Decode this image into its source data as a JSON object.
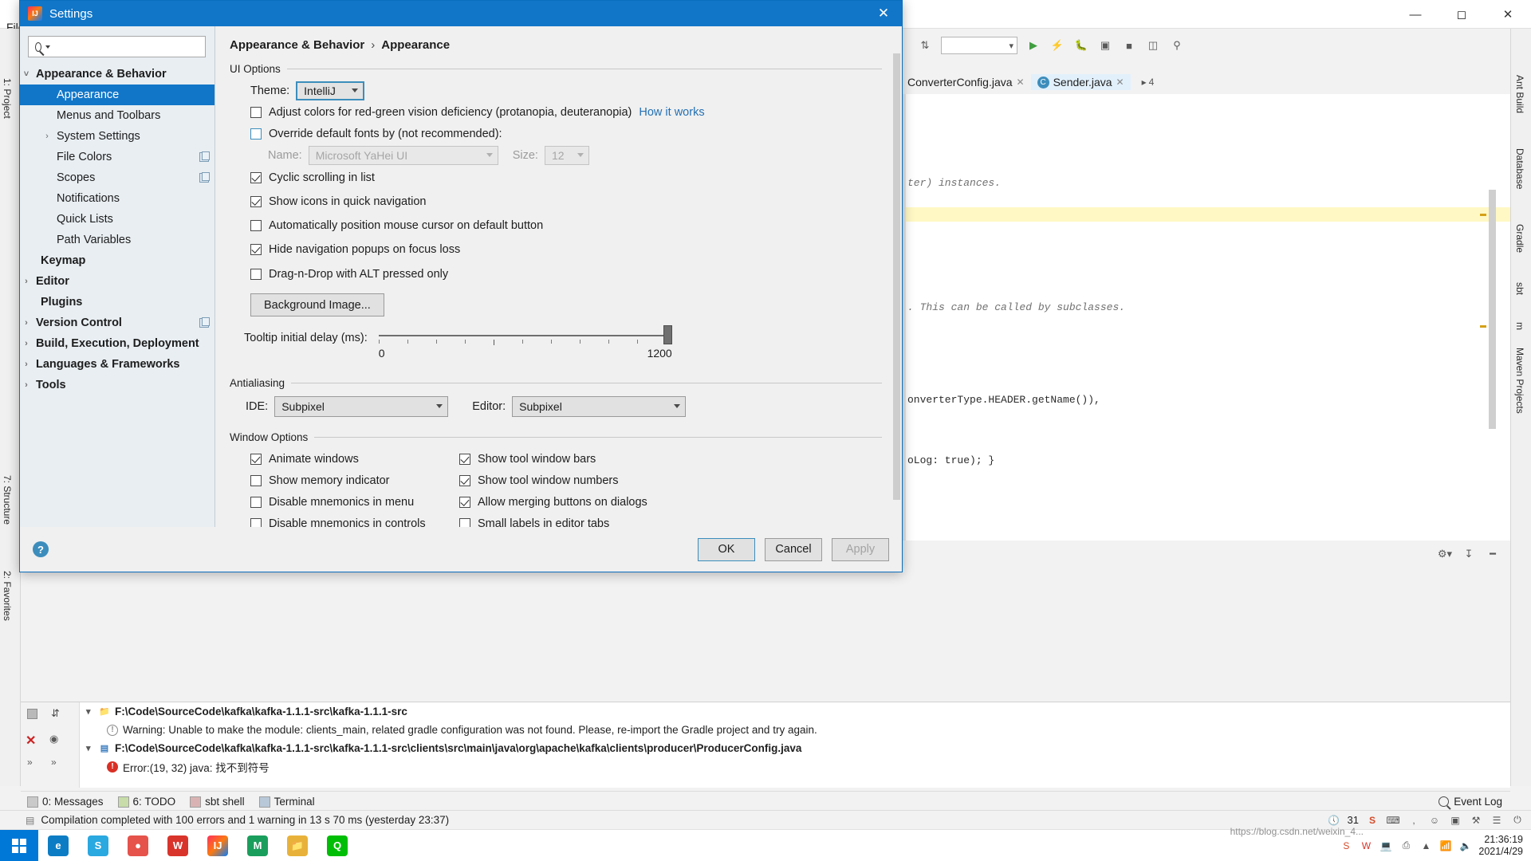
{
  "ide": {
    "menu_label": "File",
    "left_strip": [
      "1: Project",
      "7: Structure",
      "2: Favorites"
    ],
    "right_strip": [
      "Ant Build",
      "Database",
      "Gradle",
      "sbt",
      "m",
      "Maven Projects"
    ],
    "tabs": [
      {
        "label": "ConverterConfig.java",
        "badge": "",
        "active": false
      },
      {
        "label": "Sender.java",
        "badge": "C",
        "active": true
      }
    ],
    "tab_counter": "4",
    "code_lines": [
      "ter) instances.",
      ". This can be called by subclasses.",
      "onverterType.HEADER.getName()),",
      "oLog: true); }"
    ],
    "messages": [
      {
        "type": "folder",
        "bold": true,
        "text": "F:\\Code\\SourceCode\\kafka\\kafka-1.1.1-src\\kafka-1.1.1-src"
      },
      {
        "type": "warning",
        "bold": false,
        "text": "Warning: Unable to make the module: clients_main, related gradle configuration was not found. Please, re-import the Gradle project and try again."
      },
      {
        "type": "file",
        "bold": true,
        "text": "F:\\Code\\SourceCode\\kafka\\kafka-1.1.1-src\\kafka-1.1.1-src\\clients\\src\\main\\java\\org\\apache\\kafka\\clients\\producer\\ProducerConfig.java"
      },
      {
        "type": "error",
        "bold": false,
        "text": "Error:(19, 32)  java: 找不到符号"
      }
    ],
    "tool_tabs": [
      {
        "label": "0: Messages",
        "mnemonic": "0"
      },
      {
        "label": "6: TODO",
        "mnemonic": "6"
      },
      {
        "label": "sbt shell",
        "mnemonic": ""
      },
      {
        "label": "Terminal",
        "mnemonic": ""
      }
    ],
    "event_log": "Event Log",
    "status_text": "Compilation completed with 100 errors and 1 warning in 13 s 70 ms (yesterday 23:37)",
    "status_count": "31",
    "clock_time": "21:36:19",
    "clock_date": "2021/4/29",
    "watermark_url": "https://blog.csdn.net/weixin_4...",
    "watermark_2": "2021/4/29"
  },
  "dialog": {
    "title": "Settings",
    "logo_text": "IJ",
    "close_icon": "✕",
    "search": {
      "placeholder": "",
      "value": ""
    },
    "breadcrumb": {
      "parent": "Appearance & Behavior",
      "separator": "›",
      "current": "Appearance"
    },
    "sidebar": [
      {
        "label": "Appearance & Behavior",
        "level": 0,
        "arrow": "expanded",
        "bold": true,
        "selected": false,
        "badge": false
      },
      {
        "label": "Appearance",
        "level": 1,
        "arrow": "none",
        "bold": false,
        "selected": true,
        "badge": false
      },
      {
        "label": "Menus and Toolbars",
        "level": 1,
        "arrow": "none",
        "bold": false,
        "selected": false,
        "badge": false
      },
      {
        "label": "System Settings",
        "level": 1,
        "arrow": "collapsed",
        "bold": false,
        "selected": false,
        "badge": false
      },
      {
        "label": "File Colors",
        "level": 1,
        "arrow": "none",
        "bold": false,
        "selected": false,
        "badge": true
      },
      {
        "label": "Scopes",
        "level": 1,
        "arrow": "none",
        "bold": false,
        "selected": false,
        "badge": true
      },
      {
        "label": "Notifications",
        "level": 1,
        "arrow": "none",
        "bold": false,
        "selected": false,
        "badge": false
      },
      {
        "label": "Quick Lists",
        "level": 1,
        "arrow": "none",
        "bold": false,
        "selected": false,
        "badge": false
      },
      {
        "label": "Path Variables",
        "level": 1,
        "arrow": "none",
        "bold": false,
        "selected": false,
        "badge": false
      },
      {
        "label": "Keymap",
        "level": 0,
        "arrow": "none",
        "bold": true,
        "selected": false,
        "badge": false
      },
      {
        "label": "Editor",
        "level": 0,
        "arrow": "collapsed",
        "bold": true,
        "selected": false,
        "badge": false
      },
      {
        "label": "Plugins",
        "level": 0,
        "arrow": "none",
        "bold": true,
        "selected": false,
        "badge": false
      },
      {
        "label": "Version Control",
        "level": 0,
        "arrow": "collapsed",
        "bold": true,
        "selected": false,
        "badge": true
      },
      {
        "label": "Build, Execution, Deployment",
        "level": 0,
        "arrow": "collapsed",
        "bold": true,
        "selected": false,
        "badge": false
      },
      {
        "label": "Languages & Frameworks",
        "level": 0,
        "arrow": "collapsed",
        "bold": true,
        "selected": false,
        "badge": false
      },
      {
        "label": "Tools",
        "level": 0,
        "arrow": "collapsed",
        "bold": true,
        "selected": false,
        "badge": false
      }
    ],
    "ui_options": {
      "group_title": "UI Options",
      "theme_label": "Theme:",
      "theme_value": "IntelliJ",
      "adjust_colors": {
        "label": "Adjust colors for red-green vision deficiency (protanopia, deuteranopia)",
        "checked": false
      },
      "how_it_works": "How it works",
      "override_fonts": {
        "label": "Override default fonts by (not recommended):",
        "checked": false
      },
      "name_label": "Name:",
      "name_value": "Microsoft YaHei UI",
      "size_label": "Size:",
      "size_value": "12",
      "checkboxes": [
        {
          "label": "Cyclic scrolling in list",
          "checked": true
        },
        {
          "label": "Show icons in quick navigation",
          "checked": true
        },
        {
          "label": "Automatically position mouse cursor on default button",
          "checked": false
        },
        {
          "label": "Hide navigation popups on focus loss",
          "checked": true
        },
        {
          "label": "Drag-n-Drop with ALT pressed only",
          "checked": false
        }
      ],
      "background_image_button": "Background Image...",
      "tooltip_label": "Tooltip initial delay (ms):",
      "tooltip_min": "0",
      "tooltip_max": "1200",
      "tooltip_value": "1200"
    },
    "antialiasing": {
      "group_title": "Antialiasing",
      "ide_label": "IDE:",
      "ide_value": "Subpixel",
      "editor_label": "Editor:",
      "editor_value": "Subpixel"
    },
    "window_options": {
      "group_title": "Window Options",
      "left_column": [
        {
          "label": "Animate windows",
          "checked": true,
          "mnemonic": ""
        },
        {
          "label": "Show memory indicator",
          "checked": false,
          "mnemonic": ""
        },
        {
          "label": "Disable mnemonics in menu",
          "checked": false,
          "mnemonic": "m"
        },
        {
          "label": "Disable mnemonics in controls",
          "checked": false,
          "mnemonic": ""
        }
      ],
      "right_column": [
        {
          "label": "Show tool window bars",
          "checked": true
        },
        {
          "label": "Show tool window numbers",
          "checked": true
        },
        {
          "label": "Allow merging buttons on dialogs",
          "checked": true
        },
        {
          "label": "Small labels in editor tabs",
          "checked": false
        }
      ]
    },
    "footer": {
      "help": "?",
      "ok": "OK",
      "cancel": "Cancel",
      "apply": "Apply"
    }
  }
}
